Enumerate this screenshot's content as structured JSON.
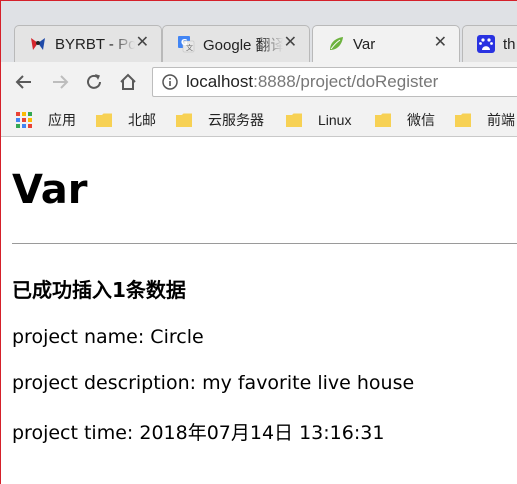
{
  "browser": {
    "tabs": [
      {
        "title": "BYRBT - Po",
        "icon": "byrbt-icon"
      },
      {
        "title": "Google 翻译",
        "icon": "google-translate-icon"
      },
      {
        "title": "Var",
        "icon": "spring-leaf-icon"
      },
      {
        "title": "th",
        "icon": "baidu-icon"
      }
    ],
    "close_glyph": "✕",
    "url_host": "localhost",
    "url_rest": ":8888/project/doRegister",
    "bookmarks": [
      {
        "label": "应用",
        "icon": "apps-grid-icon"
      },
      {
        "label": "北邮",
        "icon": "folder-icon"
      },
      {
        "label": "云服务器",
        "icon": "folder-icon"
      },
      {
        "label": "Linux",
        "icon": "folder-icon"
      },
      {
        "label": "微信",
        "icon": "folder-icon"
      },
      {
        "label": "前端",
        "icon": "folder-icon"
      }
    ]
  },
  "page": {
    "heading": "Var",
    "subheading": "已成功插入1条数据",
    "lines": [
      "project name: Circle",
      "project description: my favorite live house",
      "project time: 2018年07月14日 13:16:31"
    ]
  },
  "colors": {
    "folder": "#f7d154",
    "spring_green": "#6db33f",
    "baidu_blue": "#2932e1",
    "google_blue": "#4285f4"
  }
}
